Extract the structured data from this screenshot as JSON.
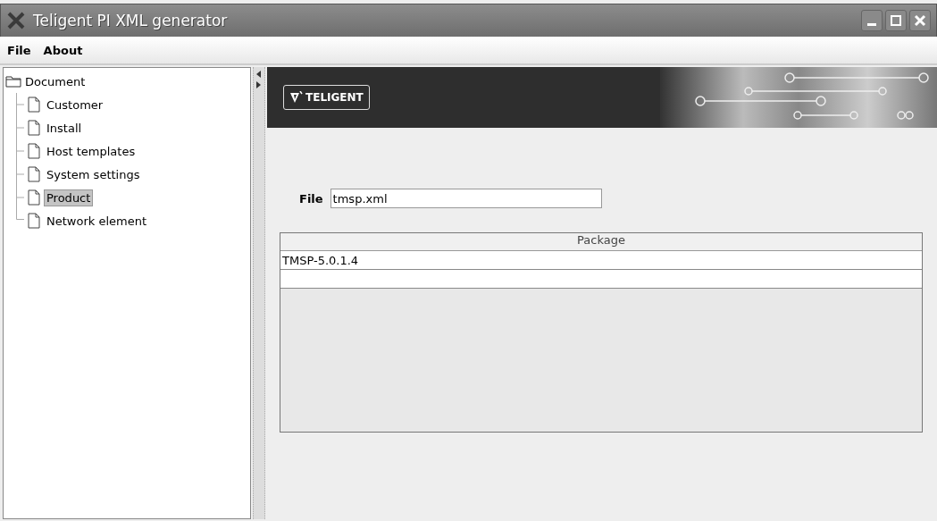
{
  "window": {
    "title": "Teligent PI XML generator"
  },
  "menu": [
    "File",
    "About"
  ],
  "tree": {
    "label": "Document",
    "expanded": true,
    "children": [
      {
        "label": "Customer",
        "selected": false
      },
      {
        "label": "Install",
        "selected": false
      },
      {
        "label": "Host templates",
        "selected": false
      },
      {
        "label": "System settings",
        "selected": false
      },
      {
        "label": "Product",
        "selected": true
      },
      {
        "label": "Network element",
        "selected": false
      }
    ]
  },
  "banner": {
    "logo": "TELIGENT"
  },
  "file": {
    "label": "File",
    "value": "tmsp.xml"
  },
  "table": {
    "columns": [
      "Package"
    ],
    "rows": [
      [
        "TMSP-5.0.1.4"
      ]
    ]
  }
}
